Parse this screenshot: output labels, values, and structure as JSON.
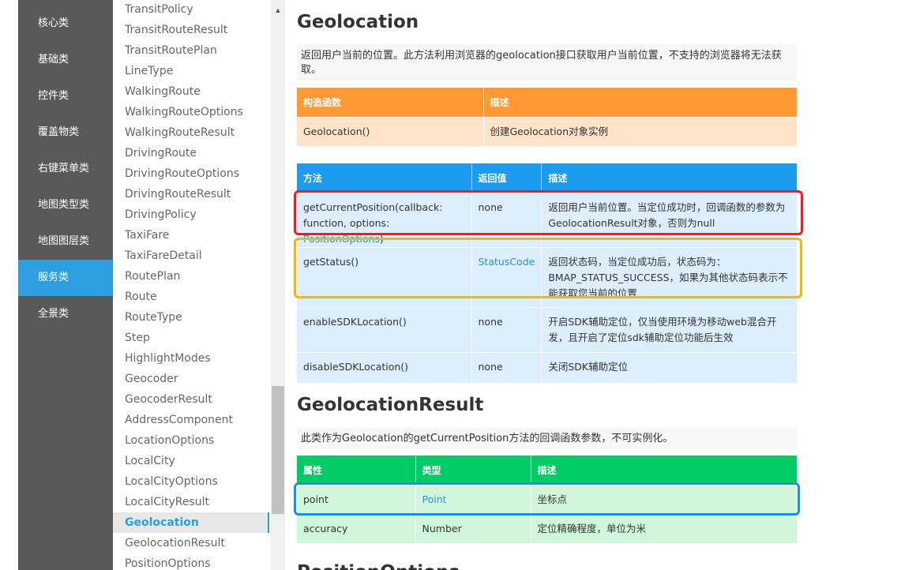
{
  "categories": [
    {
      "label": "核心类",
      "active": false
    },
    {
      "label": "基础类",
      "active": false
    },
    {
      "label": "控件类",
      "active": false
    },
    {
      "label": "覆盖物类",
      "active": false
    },
    {
      "label": "右键菜单类",
      "active": false
    },
    {
      "label": "地图类型类",
      "active": false
    },
    {
      "label": "地图图层类",
      "active": false
    },
    {
      "label": "服务类",
      "active": true
    },
    {
      "label": "全景类",
      "active": false
    }
  ],
  "classes": [
    "TransitPolicy",
    "TransitRouteResult",
    "TransitRoutePlan",
    "LineType",
    "WalkingRoute",
    "WalkingRouteOptions",
    "WalkingRouteResult",
    "DrivingRoute",
    "DrivingRouteOptions",
    "DrivingRouteResult",
    "DrivingPolicy",
    "TaxiFare",
    "TaxiFareDetail",
    "RoutePlan",
    "Route",
    "RouteType",
    "Step",
    "HighlightModes",
    "Geocoder",
    "GeocoderResult",
    "AddressComponent",
    "LocationOptions",
    "LocalCity",
    "LocalCityOptions",
    "LocalCityResult",
    "Geolocation",
    "GeolocationResult",
    "PositionOptions"
  ],
  "active_class": "Geolocation",
  "geolocation": {
    "title": "Geolocation",
    "desc": "返回用户当前的位置。此方法利用浏览器的geolocation接口获取用户当前位置，不支持的浏览器将无法获取。",
    "ctor_table": {
      "headers": [
        "构造函数",
        "描述"
      ],
      "rows": [
        [
          "Geolocation()",
          "创建Geolocation对象实例"
        ]
      ]
    },
    "method_table": {
      "headers": [
        "方法",
        "返回值",
        "描述"
      ],
      "rows": [
        {
          "method_prefix": "getCurrentPosition(callback: function, options: ",
          "method_link": "PositionOptions",
          "method_suffix": ")",
          "ret": "none",
          "ret_link": false,
          "desc": "返回用户当前位置。当定位成功时，回调函数的参数为GeolocationResult对象，否则为null"
        },
        {
          "method_prefix": "getStatus()",
          "method_link": "",
          "method_suffix": "",
          "ret": "StatusCode",
          "ret_link": true,
          "desc": "返回状态码，当定位成功后，状态码为：BMAP_STATUS_SUCCESS，如果为其他状态码表示不能获取您当前的位置"
        },
        {
          "method_prefix": "enableSDKLocation()",
          "method_link": "",
          "method_suffix": "",
          "ret": "none",
          "ret_link": false,
          "desc": "开启SDK辅助定位，仅当使用环境为移动web混合开发，且开启了定位sdk辅助定位功能后生效"
        },
        {
          "method_prefix": "disableSDKLocation()",
          "method_link": "",
          "method_suffix": "",
          "ret": "none",
          "ret_link": false,
          "desc": "关闭SDK辅助定位"
        }
      ]
    }
  },
  "geolocation_result": {
    "title": "GeolocationResult",
    "desc": "此类作为Geolocation的getCurrentPosition方法的回调函数参数，不可实例化。",
    "prop_table": {
      "headers": [
        "属性",
        "类型",
        "描述"
      ],
      "rows": [
        {
          "name": "point",
          "type": "Point",
          "type_link": true,
          "desc": "坐标点"
        },
        {
          "name": "accuracy",
          "type": "Number",
          "type_link": false,
          "desc": "定位精确程度，单位为米"
        }
      ]
    }
  },
  "next_heading": "PositionOptions",
  "highlight_colors": {
    "red": "#ee1c25",
    "yellow": "#f5b800",
    "blue": "#1a8fe8"
  }
}
